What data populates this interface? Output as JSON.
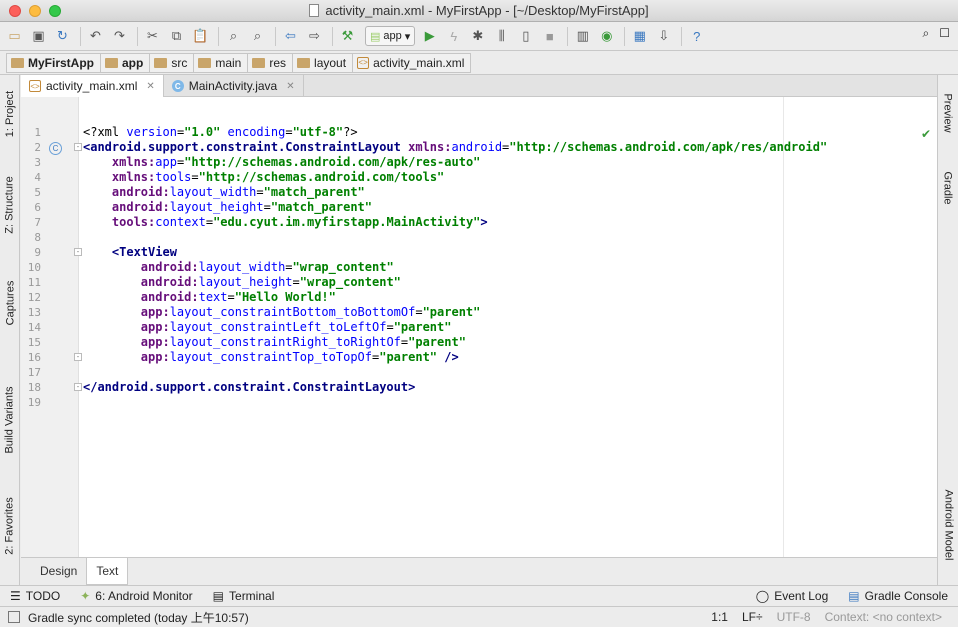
{
  "window": {
    "title": "activity_main.xml - MyFirstApp - [~/Desktop/MyFirstApp]"
  },
  "toolbar": {
    "run_config": "app",
    "icons": [
      "open-icon",
      "save-icon",
      "sync-icon",
      "undo-icon",
      "redo-icon",
      "cut-icon",
      "copy-icon",
      "paste-icon",
      "find-icon",
      "replace-icon",
      "back-icon",
      "forward-icon",
      "build-icon",
      "run-icon",
      "apply-changes-icon",
      "debug-icon",
      "attach-icon",
      "profile-icon",
      "stop-icon",
      "avd-manager-icon",
      "sdk-manager-icon",
      "project-structure-icon",
      "gradle-sync-icon",
      "help-icon"
    ]
  },
  "breadcrumb": [
    "MyFirstApp",
    "app",
    "src",
    "main",
    "res",
    "layout",
    "activity_main.xml"
  ],
  "left_tools": [
    "1: Project",
    "Z: Structure",
    "Captures",
    "Build Variants",
    "2: Favorites"
  ],
  "right_tools": [
    "Preview",
    "Gradle",
    "Android Model"
  ],
  "editor_tabs": [
    {
      "label": "activity_main.xml",
      "active": true
    },
    {
      "label": "MainActivity.java",
      "active": false
    }
  ],
  "code_lines": [
    {
      "n": "1",
      "html": "<span class='c-plain'>&lt;?xml </span><span class='c-attr'>version</span><span class='c-plain'>=</span><span class='c-val'>\"1.0\"</span><span class='c-plain'> </span><span class='c-attr'>encoding</span><span class='c-plain'>=</span><span class='c-val'>\"utf-8\"</span><span class='c-plain'>?&gt;</span>"
    },
    {
      "n": "2",
      "fold": "-",
      "html": "<span class='c-tag'>&lt;android.support.constraint.ConstraintLayout </span><span class='c-ns'>xmlns:</span><span class='c-attr'>android</span><span class='c-plain'>=</span><span class='c-val'>\"http://schemas.android.com/apk/res/android\"</span>"
    },
    {
      "n": "3",
      "html": "    <span class='c-ns'>xmlns:</span><span class='c-attr'>app</span><span class='c-plain'>=</span><span class='c-val'>\"http://schemas.android.com/apk/res-auto\"</span>"
    },
    {
      "n": "4",
      "html": "    <span class='c-ns'>xmlns:</span><span class='c-attr'>tools</span><span class='c-plain'>=</span><span class='c-val'>\"http://schemas.android.com/tools\"</span>"
    },
    {
      "n": "5",
      "html": "    <span class='c-ns'>android:</span><span class='c-attr'>layout_width</span><span class='c-plain'>=</span><span class='c-val'>\"match_parent\"</span>"
    },
    {
      "n": "6",
      "html": "    <span class='c-ns'>android:</span><span class='c-attr'>layout_height</span><span class='c-plain'>=</span><span class='c-val'>\"match_parent\"</span>"
    },
    {
      "n": "7",
      "html": "    <span class='c-ns'>tools:</span><span class='c-attr'>context</span><span class='c-plain'>=</span><span class='c-val'>\"edu.cyut.im.myfirstapp.MainActivity\"</span><span class='c-tag'>&gt;</span>"
    },
    {
      "n": "8",
      "html": ""
    },
    {
      "n": "9",
      "fold": "-",
      "html": "    <span class='c-tag'>&lt;TextView</span>"
    },
    {
      "n": "10",
      "html": "        <span class='c-ns'>android:</span><span class='c-attr'>layout_width</span><span class='c-plain'>=</span><span class='c-val'>\"wrap_content\"</span>"
    },
    {
      "n": "11",
      "html": "        <span class='c-ns'>android:</span><span class='c-attr'>layout_height</span><span class='c-plain'>=</span><span class='c-val'>\"wrap_content\"</span>"
    },
    {
      "n": "12",
      "html": "        <span class='c-ns'>android:</span><span class='c-attr'>text</span><span class='c-plain'>=</span><span class='c-val'>\"Hello World!\"</span>"
    },
    {
      "n": "13",
      "html": "        <span class='c-ns'>app:</span><span class='c-attr'>layout_constraintBottom_toBottomOf</span><span class='c-plain'>=</span><span class='c-val'>\"parent\"</span>"
    },
    {
      "n": "14",
      "html": "        <span class='c-ns'>app:</span><span class='c-attr'>layout_constraintLeft_toLeftOf</span><span class='c-plain'>=</span><span class='c-val'>\"parent\"</span>"
    },
    {
      "n": "15",
      "html": "        <span class='c-ns'>app:</span><span class='c-attr'>layout_constraintRight_toRightOf</span><span class='c-plain'>=</span><span class='c-val'>\"parent\"</span>"
    },
    {
      "n": "16",
      "fold": "-",
      "html": "        <span class='c-ns'>app:</span><span class='c-attr'>layout_constraintTop_toTopOf</span><span class='c-plain'>=</span><span class='c-val'>\"parent\"</span><span class='c-plain'> </span><span class='c-tag'>/&gt;</span>"
    },
    {
      "n": "17",
      "html": ""
    },
    {
      "n": "18",
      "fold": "-",
      "html": "<span class='c-tag'>&lt;/android.support.constraint.ConstraintLayout&gt;</span>"
    },
    {
      "n": "19",
      "html": ""
    }
  ],
  "bottom_tabs": [
    "Design",
    "Text"
  ],
  "bottom_tools": {
    "left": [
      "TODO",
      "6: Android Monitor",
      "Terminal"
    ],
    "right": [
      "Event Log",
      "Gradle Console"
    ]
  },
  "status": {
    "message": "Gradle sync completed (today 上午10:57)",
    "position": "1:1",
    "line_sep": "LF÷",
    "encoding": "UTF-8",
    "context": "Context: <no context>"
  }
}
